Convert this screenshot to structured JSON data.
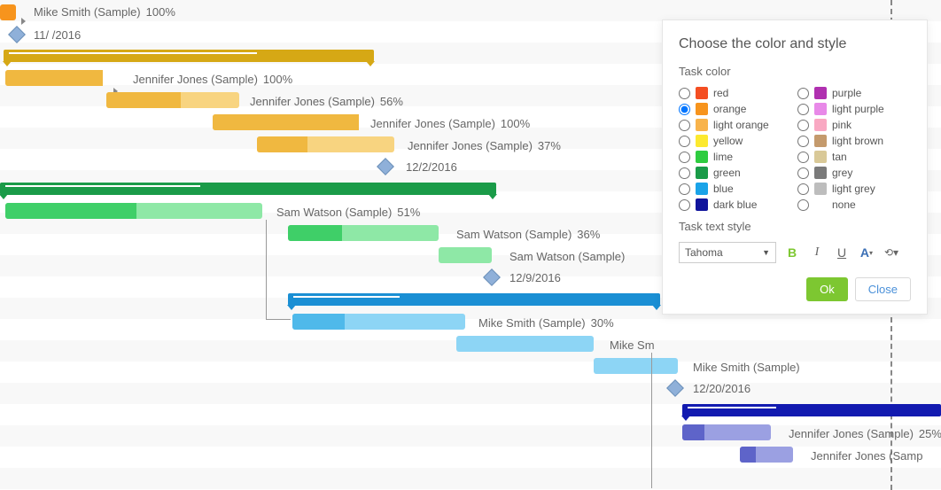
{
  "panel": {
    "title": "Choose the color and style",
    "task_color_label": "Task color",
    "task_text_style_label": "Task text style",
    "font": "Tahoma",
    "ok_label": "Ok",
    "close_label": "Close",
    "colors": {
      "red": {
        "label": "red",
        "hex": "#f44e22"
      },
      "orange": {
        "label": "orange",
        "hex": "#f7941d"
      },
      "light_orange": {
        "label": "light orange",
        "hex": "#f8b34b"
      },
      "yellow": {
        "label": "yellow",
        "hex": "#fce92f"
      },
      "lime": {
        "label": "lime",
        "hex": "#2ecc40"
      },
      "green": {
        "label": "green",
        "hex": "#1a9b48"
      },
      "blue": {
        "label": "blue",
        "hex": "#1aa3e8"
      },
      "dark_blue": {
        "label": "dark blue",
        "hex": "#10149c"
      },
      "purple": {
        "label": "purple",
        "hex": "#b030b0"
      },
      "light_purple": {
        "label": "light purple",
        "hex": "#e889e8"
      },
      "pink": {
        "label": "pink",
        "hex": "#f9a8c2"
      },
      "light_brown": {
        "label": "light brown",
        "hex": "#c49a6c"
      },
      "tan": {
        "label": "tan",
        "hex": "#d9c998"
      },
      "grey": {
        "label": "grey",
        "hex": "#7a7a7a"
      },
      "light_grey": {
        "label": "light grey",
        "hex": "#bdbdbd"
      },
      "none": {
        "label": "none",
        "hex": ""
      }
    },
    "selected_color": "orange"
  },
  "gantt": {
    "rows": [
      {
        "name": "Mike Smith (Sample)",
        "pct": "100%"
      },
      {
        "name": "",
        "date": "11/  /2016"
      },
      {
        "name": "Jennifer Jones (Sample)",
        "pct": "100%"
      },
      {
        "name": "Jennifer Jones (Sample)",
        "pct": "56%"
      },
      {
        "name": "Jennifer Jones (Sample)",
        "pct": "100%"
      },
      {
        "name": "Jennifer Jones (Sample)",
        "pct": "37%"
      },
      {
        "name": "",
        "date": "12/2/2016"
      },
      {
        "name": "Sam Watson (Sample)",
        "pct": "51%"
      },
      {
        "name": "Sam Watson (Sample)",
        "pct": "36%"
      },
      {
        "name": "Sam Watson (Sample)",
        "pct": ""
      },
      {
        "name": "",
        "date": "12/9/2016"
      },
      {
        "name": "Mike Smith (Sample)",
        "pct": "30%"
      },
      {
        "name": "Mike Sm",
        "pct": ""
      },
      {
        "name": "Mike Smith (Sample)",
        "pct": ""
      },
      {
        "name": "",
        "date": "12/20/2016"
      },
      {
        "name": "Jennifer Jones (Sample)",
        "pct": "25%"
      },
      {
        "name": "Jennifer Jones (Samp",
        "pct": ""
      }
    ]
  }
}
